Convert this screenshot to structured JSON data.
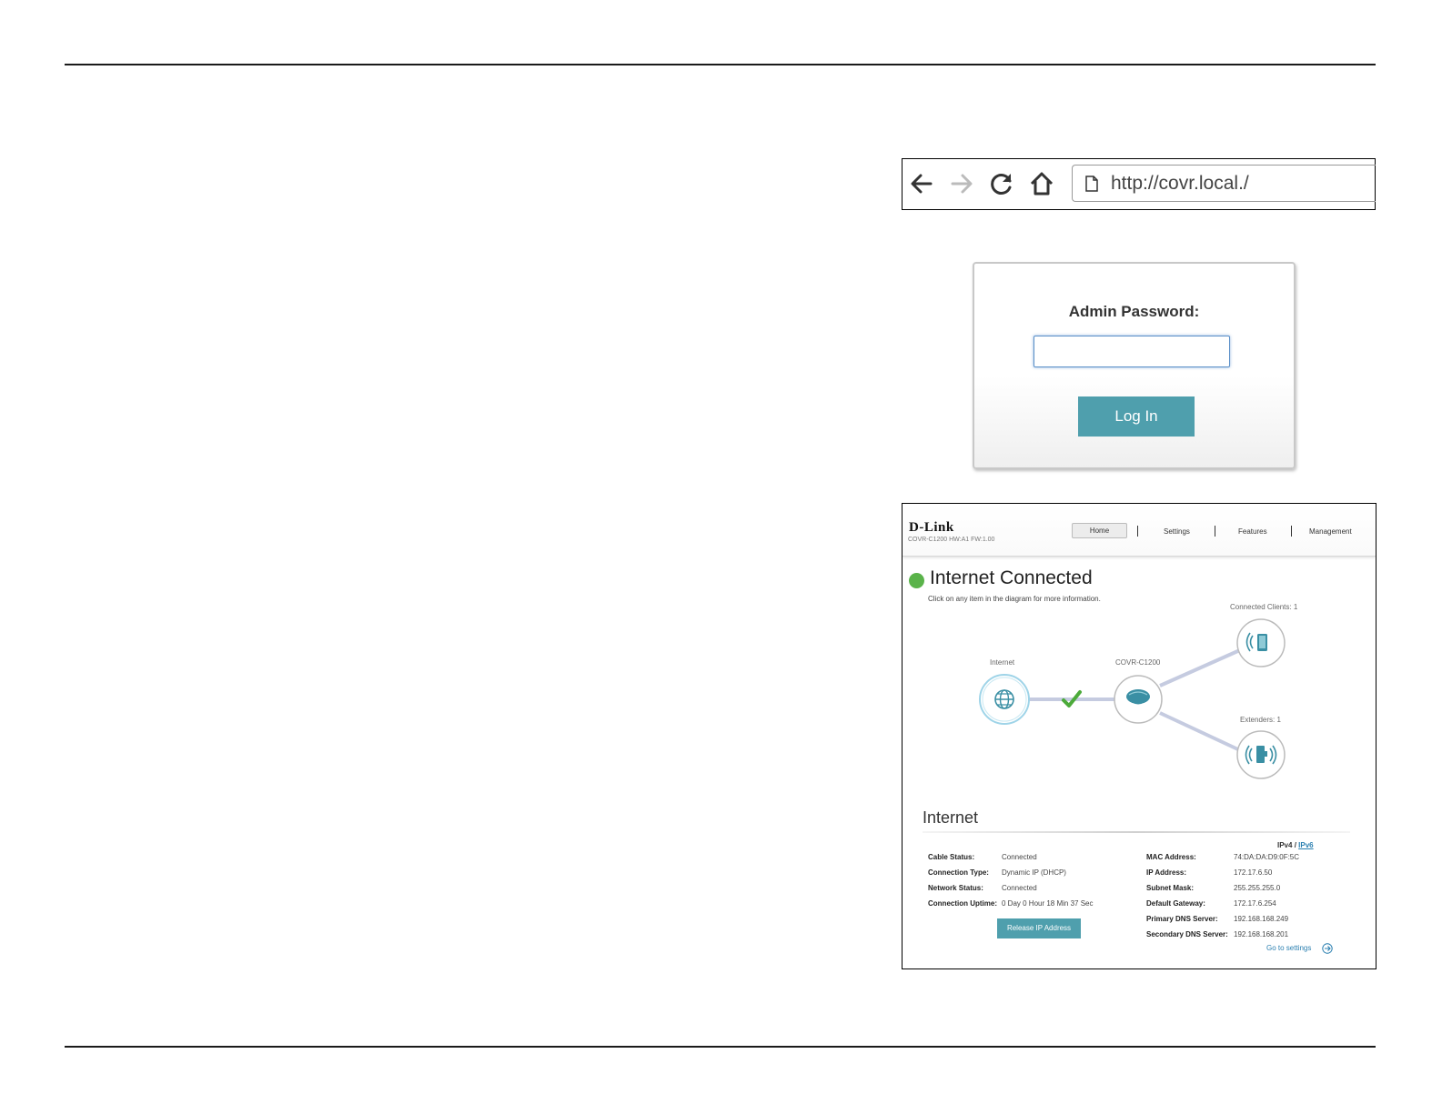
{
  "browser": {
    "url": "http://covr.local./"
  },
  "login": {
    "label": "Admin Password:",
    "password_value": "",
    "button": "Log In"
  },
  "dashboard": {
    "brand": "D-Link",
    "model_info": "COVR-C1200 HW:A1 FW:1.00",
    "nav": [
      "Home",
      "Settings",
      "Features",
      "Management"
    ],
    "status_title": "Internet Connected",
    "hint": "Click on any item in the diagram for more information.",
    "diagram": {
      "internet_label": "Internet",
      "router_label": "COVR-C1200",
      "clients_label": "Connected Clients: 1",
      "extenders_label": "Extenders: 1"
    },
    "section_title": "Internet",
    "ipv4": "IPv4",
    "slash": "/",
    "ipv6": "IPv6",
    "left_info": [
      {
        "k": "Cable Status:",
        "v": "Connected"
      },
      {
        "k": "Connection Type:",
        "v": "Dynamic IP (DHCP)"
      },
      {
        "k": "Network Status:",
        "v": "Connected"
      },
      {
        "k": "Connection Uptime:",
        "v": "0 Day 0 Hour 18 Min 37 Sec"
      }
    ],
    "right_info": [
      {
        "k": "MAC Address:",
        "v": "74:DA:DA:D9:0F:5C"
      },
      {
        "k": "IP Address:",
        "v": "172.17.6.50"
      },
      {
        "k": "Subnet Mask:",
        "v": "255.255.255.0"
      },
      {
        "k": "Default Gateway:",
        "v": "172.17.6.254"
      },
      {
        "k": "Primary DNS Server:",
        "v": "192.168.168.249"
      },
      {
        "k": "Secondary DNS Server:",
        "v": "192.168.168.201"
      }
    ],
    "release_button": "Release IP Address",
    "goto_settings": "Go to settings"
  },
  "colors": {
    "accent": "#4f9fad",
    "status_green": "#5ab34a",
    "link": "#2a7fb0"
  }
}
